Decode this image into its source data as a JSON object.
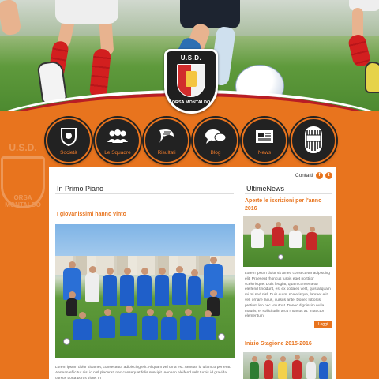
{
  "crest": {
    "top_text": "U.S.D.",
    "bottom_text": "ORSA MONTALDO"
  },
  "nav": [
    {
      "label": "Società",
      "icon": "crest-icon"
    },
    {
      "label": "Le Squadre",
      "icon": "group-icon"
    },
    {
      "label": "Risultati",
      "icon": "trophy-icon"
    },
    {
      "label": "Blog",
      "icon": "chat-bubbles-icon"
    },
    {
      "label": "News",
      "icon": "newspaper-icon"
    },
    {
      "label": "",
      "icon": "juventus-logo-icon"
    }
  ],
  "header": {
    "contatti": "Contatti"
  },
  "social": {
    "facebook": "f",
    "twitter": "t"
  },
  "main": {
    "title": "In Primo Piano",
    "article_title": "I giovanissimi hanno vinto",
    "article_text": "Lorem ipsum dolor sit amet, consectetur adipiscing elit. Aliquam vel urna est. Aenean id ullamcorper erat. Aenean efficitur nisl id nisl placerat, nec consequat felis suscipit. Aenean eleifend velit turpis id gravida cursus porta purus vitae. In"
  },
  "sidebar": {
    "title": "UltimeNews",
    "news": [
      {
        "title": "Aperte le iscrizioni per l'anno 2016",
        "text": "Lorem ipsum dolor sit amet, consectetur adipiscing elit. Praesent rhoncus turpis eget porttitor scelerisque. Duis feugiat, quam consectetur eleifend tincidunt, est ex sodales velit, quis aliquam mi mi sed nisl. Duis eu mi scelerisque, laoreet elit vel, ornare lacus, cursus ante. Donec lobortis pretium leo nec volutpat. Donec dignissim nulla mauris, et sollicitudin arcu rhoncus at. In auctor elementum",
        "button": "Leggi"
      },
      {
        "title": "Inizio Stagione 2015-2016"
      }
    ]
  },
  "watermark": {
    "top": "U.S.D.",
    "bottom": "ORSA MONTALDO"
  },
  "colors": {
    "accent": "#e8741e",
    "dark": "#222222",
    "red": "#b81d25"
  }
}
